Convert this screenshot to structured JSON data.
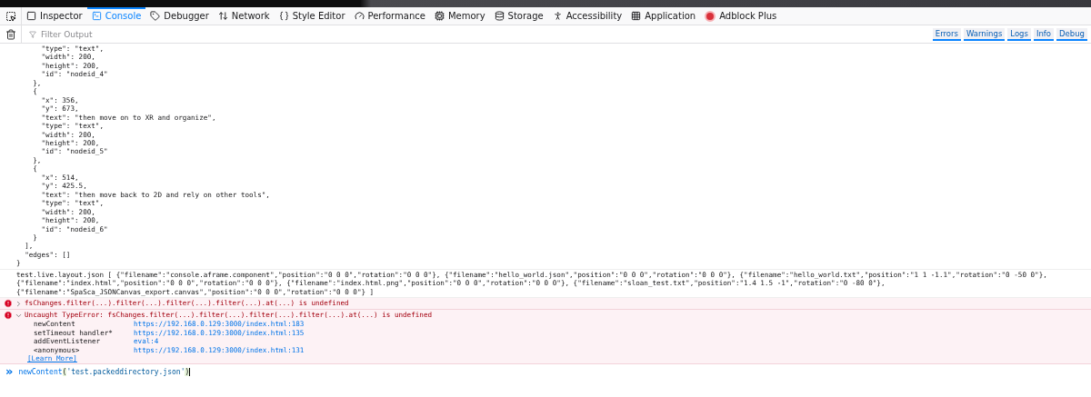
{
  "toolbar": {
    "tabs": [
      {
        "label": "Inspector",
        "selected": false
      },
      {
        "label": "Console",
        "selected": true
      },
      {
        "label": "Debugger",
        "selected": false
      },
      {
        "label": "Network",
        "selected": false
      },
      {
        "label": "Style Editor",
        "selected": false
      },
      {
        "label": "Performance",
        "selected": false
      },
      {
        "label": "Memory",
        "selected": false
      },
      {
        "label": "Storage",
        "selected": false
      },
      {
        "label": "Accessibility",
        "selected": false
      },
      {
        "label": "Application",
        "selected": false
      },
      {
        "label": "Adblock Plus",
        "selected": false
      }
    ]
  },
  "filter_bar": {
    "placeholder": "Filter Output",
    "levels": [
      {
        "label": "Errors",
        "selected": true
      },
      {
        "label": "Warnings",
        "selected": true
      },
      {
        "label": "Logs",
        "selected": true
      },
      {
        "label": "Info",
        "selected": true
      },
      {
        "label": "Debug",
        "selected": true
      }
    ]
  },
  "messages": [
    {
      "kind": "log",
      "lines": [
        "      \"type\": \"text\",",
        "      \"width\": 200,",
        "      \"height\": 200,",
        "      \"id\": \"nodeid_4\"",
        "    },",
        "    {",
        "      \"x\": 356,",
        "      \"y\": 673,",
        "      \"text\": \"then move on to XR and organize\",",
        "      \"type\": \"text\",",
        "      \"width\": 200,",
        "      \"height\": 200,",
        "      \"id\": \"nodeid_5\"",
        "    },",
        "    {",
        "      \"x\": 514,",
        "      \"y\": 425.5,",
        "      \"text\": \"then move back to 2D and rely on other tools\",",
        "      \"type\": \"text\",",
        "      \"width\": 200,",
        "      \"height\": 200,",
        "      \"id\": \"nodeid_6\"",
        "    }",
        "  ],",
        "  \"edges\": []",
        "}"
      ]
    },
    {
      "kind": "log",
      "lines": [
        "test.live.layout.json [ {\"filename\":\"console.aframe.component\",\"position\":\"0 0 0\",\"rotation\":\"0 0 0\"}, {\"filename\":\"hello_world.json\",\"position\":\"0 0 0\",\"rotation\":\"0 0 0\"}, {\"filename\":\"hello_world.txt\",\"position\":\"1 1 -1.1\",\"rotation\":\"0 -50 0\"},",
        "{\"filename\":\"index.html\",\"position\":\"0 0 0\",\"rotation\":\"0 0 0\"}, {\"filename\":\"index.html.png\",\"position\":\"0 0 0\",\"rotation\":\"0 0 0\"}, {\"filename\":\"sloan_test.txt\",\"position\":\"1.4 1.5 -1\",\"rotation\":\"0 -80 0\"},",
        "{\"filename\":\"SpaSca_JSONCanvas_export.canvas\",\"position\":\"0 0 0\",\"rotation\":\"0 0 0\"} ]"
      ]
    },
    {
      "kind": "error",
      "expanded": false,
      "text": "fsChanges.filter(...).filter(...).filter(...).filter(...).at(...) is undefined"
    },
    {
      "kind": "error",
      "expanded": true,
      "text": "Uncaught TypeError: fsChanges.filter(...).filter(...).filter(...).filter(...).at(...) is undefined",
      "stack": [
        {
          "fn": "newContent",
          "loc": "https://192.168.0.129:3000/index.html:183"
        },
        {
          "fn": "setTimeout handler*",
          "loc": "https://192.168.0.129:3000/index.html:135"
        },
        {
          "fn": "addEventListener",
          "loc": "eval:4"
        },
        {
          "fn": "<anonymous>",
          "loc": "https://192.168.0.129:3000/index.html:131"
        }
      ],
      "link": "[Learn More]"
    }
  ],
  "input": {
    "prompt": "»",
    "fn": "newContent",
    "open": "(",
    "arg": "'test.packeddirectory.json'",
    "close": ")"
  }
}
